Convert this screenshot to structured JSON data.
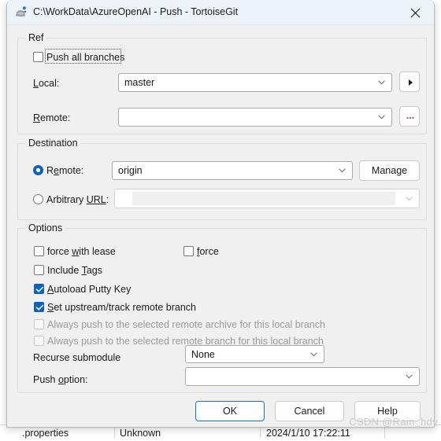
{
  "window": {
    "title": "C:\\WorkData\\AzureOpenAI - Push - TortoiseGit",
    "icon": "tortoisegit-turtle-icon",
    "close_label": "✕"
  },
  "ref": {
    "group_label": "Ref",
    "push_all_branches": {
      "label": "Push all branches",
      "checked": false,
      "focused": true
    },
    "local": {
      "label": "Local:",
      "value": "master",
      "browse_button": "▶"
    },
    "remote": {
      "label": "Remote:",
      "value": "",
      "browse_button": "..."
    }
  },
  "destination": {
    "group_label": "Destination",
    "remote": {
      "label": "Remote:",
      "selected": true,
      "value": "origin"
    },
    "manage_button": "Manage",
    "arbitrary_url": {
      "label": "Arbitrary URL:",
      "selected": false,
      "value": "",
      "disabled": true
    }
  },
  "options": {
    "group_label": "Options",
    "checkboxes": [
      {
        "label": "force with lease",
        "checked": false,
        "disabled": false
      },
      {
        "label": "force",
        "checked": false,
        "disabled": false
      },
      {
        "label": "Include Tags",
        "checked": false,
        "disabled": false
      },
      {
        "label": "Autoload Putty Key",
        "checked": true,
        "disabled": false
      },
      {
        "label": "Set upstream/track remote branch",
        "checked": true,
        "disabled": false
      },
      {
        "label": "Always push to the selected remote archive for this local branch",
        "checked": false,
        "disabled": true
      },
      {
        "label": "Always push to the selected remote branch for this local branch",
        "checked": false,
        "disabled": true
      }
    ],
    "recurse_submodule": {
      "label": "Recurse submodule",
      "value": "None"
    },
    "push_option": {
      "label": "Push option:",
      "value": ""
    }
  },
  "buttons": {
    "ok": "OK",
    "cancel": "Cancel",
    "help": "Help"
  },
  "background": {
    "file_cell": ".properties",
    "status_cell": "Unknown",
    "date_cell": "2024/1/10 17:22:11"
  },
  "watermark": "CSDN @Rain_hdy",
  "colors": {
    "accent": "#0f62b5",
    "default_button_border": "#1874c6",
    "dialog_bg": "#f0f0f0",
    "titlebar_bg": "#eef3f9"
  }
}
